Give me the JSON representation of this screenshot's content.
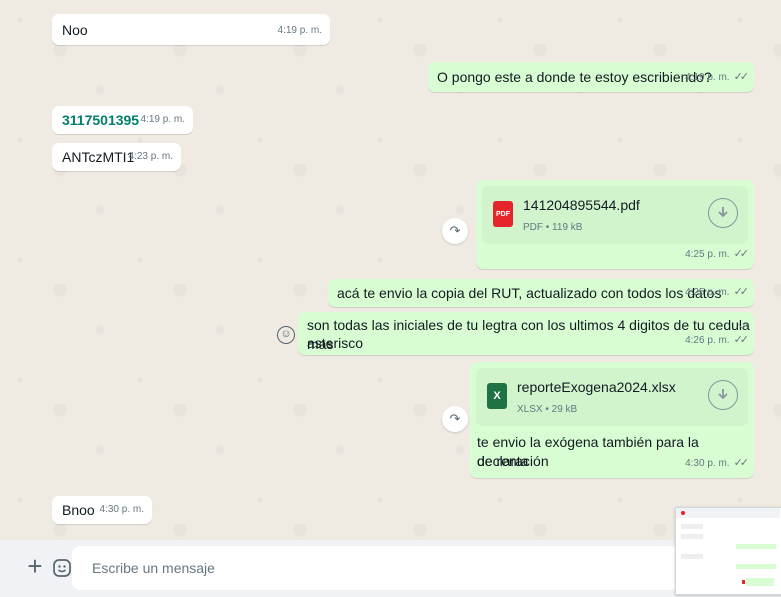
{
  "messages": {
    "m1": {
      "text": "Noo",
      "time": "4:19 p. m."
    },
    "m2": {
      "text": "O pongo este a donde te estoy escribiendo?",
      "time": "4:19 p. m."
    },
    "m3": {
      "text": "3117501395",
      "time": "4:19 p. m."
    },
    "m4": {
      "text": "ANTczMTI1",
      "time": "4:23 p. m."
    },
    "m5": {
      "file_name": "141204895544.pdf",
      "file_meta": "PDF • 119 kB",
      "file_icon": "PDF",
      "time": "4:25 p. m."
    },
    "m6": {
      "text": "acá te envio la copia del RUT, actualizado con todos los datos",
      "time": "4:25 p. m."
    },
    "m7": {
      "line1": "son todas las iniciales de tu legtra con los ultimos 4 digitos de tu cedula mas",
      "line2": "asterisco",
      "time": "4:26 p. m."
    },
    "m8": {
      "file_name": "reporteExogena2024.xlsx",
      "file_meta": "XLSX • 29 kB",
      "file_icon": "X",
      "caption1": "te envio la exógena también para la declaración",
      "caption2": "de renta",
      "time": "4:30 p. m."
    },
    "m9": {
      "text": "Bnoo",
      "time": "4:30 p. m."
    }
  },
  "composer": {
    "placeholder": "Escribe un mensaje"
  },
  "colors": {
    "incoming": "#ffffff",
    "outgoing": "#d9fdd3",
    "link_green": "#008069",
    "pdf_red": "#e5252a",
    "xlsx_green": "#1f7244"
  }
}
